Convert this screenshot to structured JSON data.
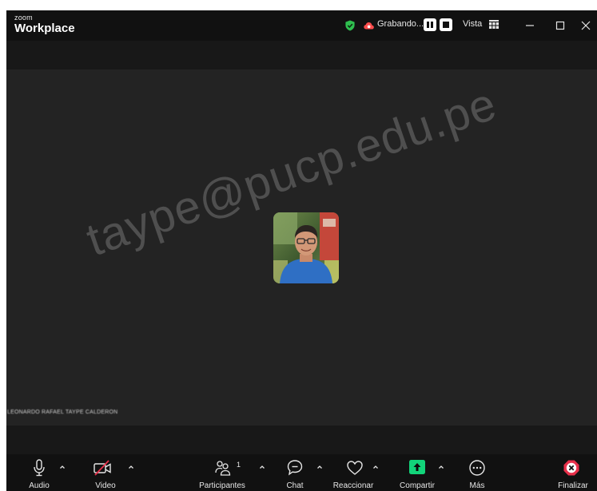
{
  "window": {
    "brand_small": "zoom",
    "brand_big": "Workplace",
    "recording_label": "Grabando...",
    "view_label": "Vista"
  },
  "meeting": {
    "watermark": "taype@pucp.edu.pe",
    "participant_name": "LEONARDO RAFAEL TAYPE CALDERON"
  },
  "toolbar": {
    "audio": "Audio",
    "video": "Video",
    "participants": "Participantes",
    "participant_count": "1",
    "chat": "Chat",
    "react": "Reaccionar",
    "share": "Compartir",
    "more": "Más",
    "end": "Finalizar"
  },
  "colors": {
    "background": "#1f1f1f",
    "shield": "#2fbf4f",
    "share": "#12d47a",
    "end": "#e8304a",
    "video_off_slash": "#e8304a"
  },
  "icons": [
    "shield-check-icon",
    "cloud-record-icon",
    "pause-icon",
    "stop-icon",
    "grid-view-icon",
    "microphone-icon",
    "video-off-icon",
    "participants-icon",
    "chat-icon",
    "heart-icon",
    "share-arrow-icon",
    "more-icon",
    "end-icon"
  ]
}
